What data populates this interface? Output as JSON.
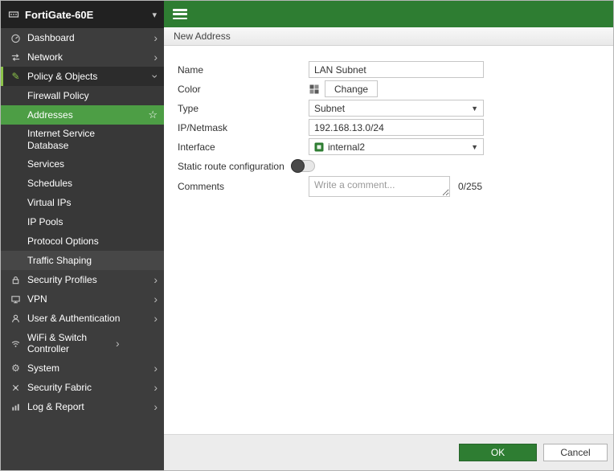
{
  "app": {
    "device_name": "FortiGate-60E"
  },
  "header": {
    "title": "New Address"
  },
  "sidebar": {
    "items_top": [
      {
        "label": "Dashboard",
        "icon": "gauge-icon"
      },
      {
        "label": "Network",
        "icon": "network-arrows-icon"
      }
    ],
    "policy": {
      "label": "Policy & Objects",
      "icon": "pencil-icon"
    },
    "policy_children": [
      {
        "label": "Firewall Policy"
      },
      {
        "label": "Addresses",
        "favorite": "star-icon",
        "active": true
      },
      {
        "label": "Internet Service Database"
      },
      {
        "label": "Services"
      },
      {
        "label": "Schedules"
      },
      {
        "label": "Virtual IPs"
      },
      {
        "label": "IP Pools"
      },
      {
        "label": "Protocol Options"
      },
      {
        "label": "Traffic Shaping"
      }
    ],
    "items_bottom": [
      {
        "label": "Security Profiles",
        "icon": "lock-icon"
      },
      {
        "label": "VPN",
        "icon": "monitor-icon"
      },
      {
        "label": "User & Authentication",
        "icon": "person-icon"
      },
      {
        "label": "WiFi & Switch Controller",
        "icon": "wifi-icon"
      },
      {
        "label": "System",
        "icon": "gear-icon"
      },
      {
        "label": "Security Fabric",
        "icon": "fabric-icon"
      },
      {
        "label": "Log & Report",
        "icon": "bar-chart-icon"
      }
    ]
  },
  "form": {
    "name": {
      "label": "Name",
      "value": "LAN Subnet"
    },
    "color": {
      "label": "Color",
      "button": "Change",
      "icon": "palette-icon"
    },
    "type": {
      "label": "Type",
      "value": "Subnet"
    },
    "ip": {
      "label": "IP/Netmask",
      "value": "192.168.13.0/24"
    },
    "interface": {
      "label": "Interface",
      "value": "internal2",
      "icon": "interface-port-icon"
    },
    "static_route": {
      "label": "Static route configuration",
      "state": "off"
    },
    "comments": {
      "label": "Comments",
      "placeholder": "Write a comment...",
      "counter": "0/255"
    }
  },
  "footer": {
    "ok": "OK",
    "cancel": "Cancel"
  },
  "colors": {
    "topbar_green": "#2e7d32",
    "active_item_green": "#4d9e45",
    "icon_green": "#8bc34a",
    "sidebar_bg": "#3d3d3d",
    "device_header_bg": "#212121"
  }
}
